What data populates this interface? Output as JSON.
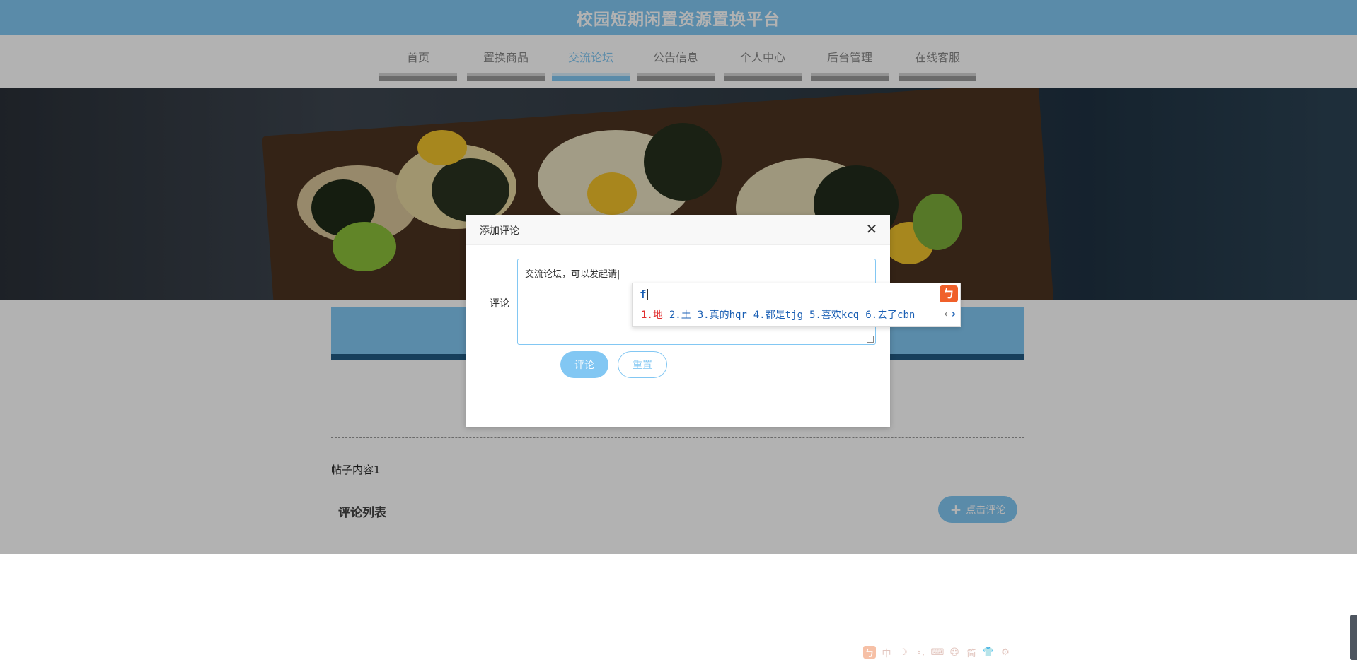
{
  "app": {
    "title": "校园短期闲置资源置换平台"
  },
  "nav": {
    "items": [
      {
        "label": "首页",
        "active": false
      },
      {
        "label": "置换商品",
        "active": false
      },
      {
        "label": "交流论坛",
        "active": true
      },
      {
        "label": "公告信息",
        "active": false
      },
      {
        "label": "个人中心",
        "active": false
      },
      {
        "label": "后台管理",
        "active": false
      },
      {
        "label": "在线客服",
        "active": false
      }
    ]
  },
  "page": {
    "post_content": "帖子内容1",
    "comments_title": "评论列表",
    "add_comment_label": "点击评论"
  },
  "modal": {
    "title": "添加评论",
    "field_label": "评论",
    "comment_value": "交流论坛，可以发起请",
    "submit_label": "评论",
    "reset_label": "重置"
  },
  "ime": {
    "input": "f",
    "candidates": [
      "1.地",
      "2.土",
      "3.真的hqr",
      "4.都是tjg",
      "5.喜欢kcq",
      "6.去了cbn"
    ],
    "toolbar": [
      "中",
      "☽",
      "∘,",
      "⌨",
      "☺",
      "简",
      "👕",
      "⚙"
    ]
  },
  "colors": {
    "accent": "#82c7f3",
    "dark_bar": "#225b85",
    "ime_highlight": "#e02d2d",
    "ime_text": "#1a5fb4"
  }
}
